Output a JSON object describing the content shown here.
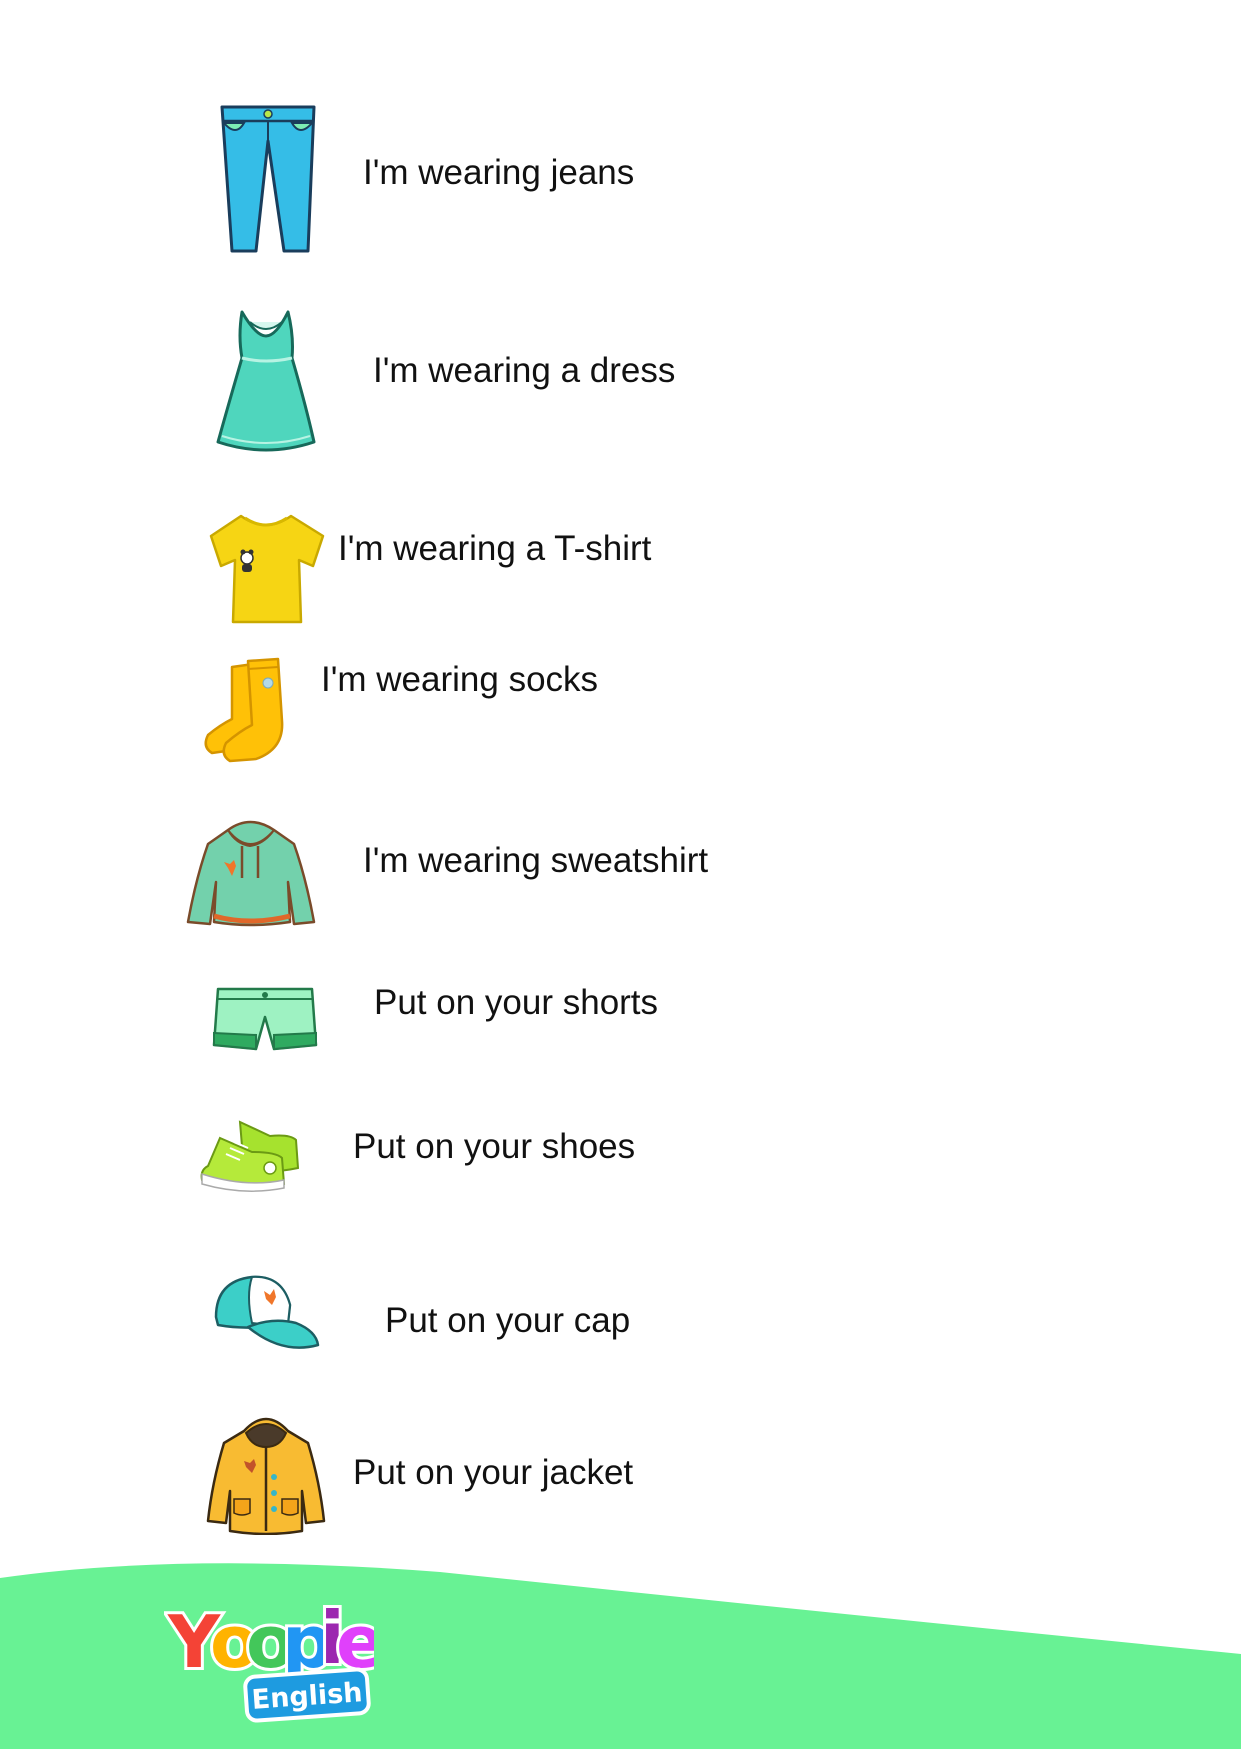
{
  "items": [
    {
      "icon": "jeans-icon",
      "label": "I'm wearing jeans"
    },
    {
      "icon": "dress-icon",
      "label": "I'm wearing a dress"
    },
    {
      "icon": "tshirt-icon",
      "label": "I'm wearing a T-shirt"
    },
    {
      "icon": "socks-icon",
      "label": "I'm wearing socks"
    },
    {
      "icon": "sweatshirt-icon",
      "label": "I'm wearing sweatshirt"
    },
    {
      "icon": "shorts-icon",
      "label": "Put on your shorts"
    },
    {
      "icon": "shoes-icon",
      "label": "Put on your shoes"
    },
    {
      "icon": "cap-icon",
      "label": "Put on your cap"
    },
    {
      "icon": "jacket-icon",
      "label": "Put on your jacket"
    }
  ],
  "logo": {
    "letters": [
      "Y",
      "o",
      "o",
      "p",
      "i",
      "e"
    ],
    "letter_colors": [
      "#f44336",
      "#ffb300",
      "#43c75a",
      "#2196f3",
      "#9c27b0",
      "#e040fb"
    ],
    "badge_text": "English"
  },
  "colors": {
    "footer_wave": "#68f294",
    "badge": "#1e9be0"
  }
}
